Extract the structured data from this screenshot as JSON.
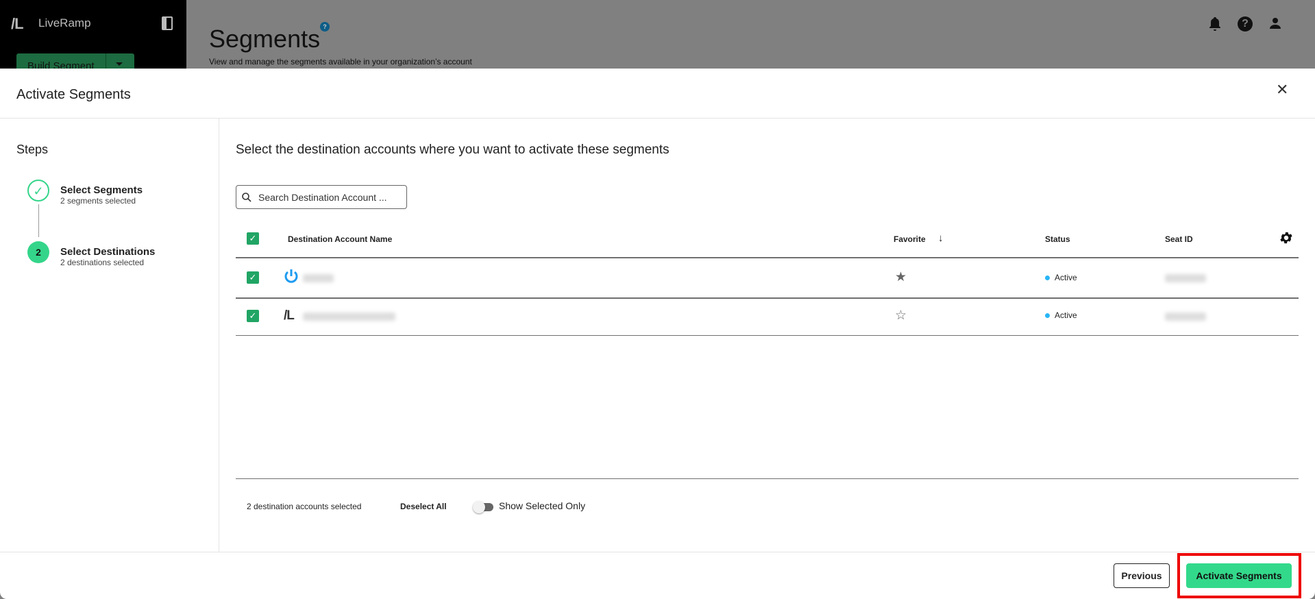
{
  "app": {
    "logo_mark": "/L",
    "name": "LiveRamp",
    "build_button": "Build Segment"
  },
  "page": {
    "title": "Segments",
    "help_icon": "?",
    "subtitle": "View and manage the segments available in your organization’s account"
  },
  "modal": {
    "title": "Activate Segments",
    "steps_label": "Steps",
    "steps": [
      {
        "title": "Select Segments",
        "subtitle": "2 segments selected",
        "status": "complete"
      },
      {
        "number": "2",
        "title": "Select Destinations",
        "subtitle": "2 destinations selected",
        "status": "current"
      }
    ],
    "heading": "Select the destination accounts where you want to activate these segments",
    "search_placeholder": "Search Destination Account ...",
    "columns": {
      "name": "Destination Account Name",
      "favorite": "Favorite",
      "status": "Status",
      "seat_id": "Seat ID"
    },
    "rows": [
      {
        "logo": "power-icon",
        "favorite": true,
        "status": "Active",
        "checked": true
      },
      {
        "logo": "/L",
        "favorite": false,
        "status": "Active",
        "checked": true
      }
    ],
    "footer": {
      "selected_count": "2 destination accounts selected",
      "deselect_all": "Deselect All",
      "show_selected_only": "Show Selected Only",
      "show_selected_on": false
    },
    "buttons": {
      "previous": "Previous",
      "activate": "Activate Segments"
    }
  },
  "colors": {
    "accent": "#33d98a",
    "checkbox": "#21a564",
    "status_active": "#29b6f6",
    "highlight": "#ee0000"
  }
}
